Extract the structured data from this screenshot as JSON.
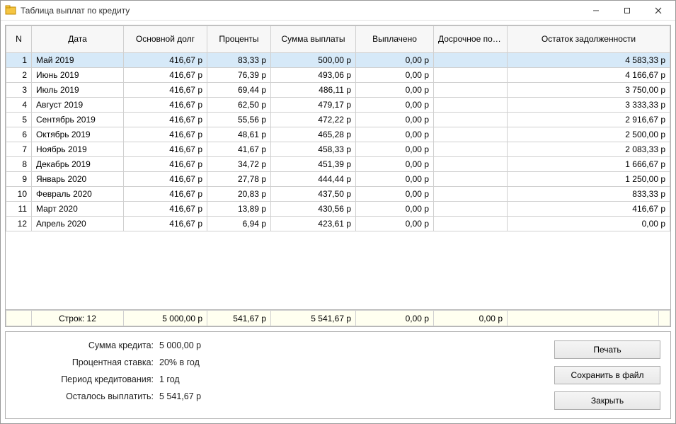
{
  "window": {
    "title": "Таблица выплат по кредиту"
  },
  "columns": {
    "n": "N",
    "date": "Дата",
    "principal": "Основной долг",
    "interest": "Проценты",
    "payment": "Сумма выплаты",
    "paid": "Выплачено",
    "early": "Досрочное погашение",
    "balance": "Остаток задолженности"
  },
  "rows": [
    {
      "n": "1",
      "date": "Май 2019",
      "principal": "416,67 р",
      "interest": "83,33 р",
      "payment": "500,00 р",
      "paid": "0,00 р",
      "early": "",
      "balance": "4 583,33 р"
    },
    {
      "n": "2",
      "date": "Июнь 2019",
      "principal": "416,67 р",
      "interest": "76,39 р",
      "payment": "493,06 р",
      "paid": "0,00 р",
      "early": "",
      "balance": "4 166,67 р"
    },
    {
      "n": "3",
      "date": "Июль 2019",
      "principal": "416,67 р",
      "interest": "69,44 р",
      "payment": "486,11 р",
      "paid": "0,00 р",
      "early": "",
      "balance": "3 750,00 р"
    },
    {
      "n": "4",
      "date": "Август 2019",
      "principal": "416,67 р",
      "interest": "62,50 р",
      "payment": "479,17 р",
      "paid": "0,00 р",
      "early": "",
      "balance": "3 333,33 р"
    },
    {
      "n": "5",
      "date": "Сентябрь 2019",
      "principal": "416,67 р",
      "interest": "55,56 р",
      "payment": "472,22 р",
      "paid": "0,00 р",
      "early": "",
      "balance": "2 916,67 р"
    },
    {
      "n": "6",
      "date": "Октябрь 2019",
      "principal": "416,67 р",
      "interest": "48,61 р",
      "payment": "465,28 р",
      "paid": "0,00 р",
      "early": "",
      "balance": "2 500,00 р"
    },
    {
      "n": "7",
      "date": "Ноябрь 2019",
      "principal": "416,67 р",
      "interest": "41,67 р",
      "payment": "458,33 р",
      "paid": "0,00 р",
      "early": "",
      "balance": "2 083,33 р"
    },
    {
      "n": "8",
      "date": "Декабрь 2019",
      "principal": "416,67 р",
      "interest": "34,72 р",
      "payment": "451,39 р",
      "paid": "0,00 р",
      "early": "",
      "balance": "1 666,67 р"
    },
    {
      "n": "9",
      "date": "Январь 2020",
      "principal": "416,67 р",
      "interest": "27,78 р",
      "payment": "444,44 р",
      "paid": "0,00 р",
      "early": "",
      "balance": "1 250,00 р"
    },
    {
      "n": "10",
      "date": "Февраль 2020",
      "principal": "416,67 р",
      "interest": "20,83 р",
      "payment": "437,50 р",
      "paid": "0,00 р",
      "early": "",
      "balance": "833,33 р"
    },
    {
      "n": "11",
      "date": "Март 2020",
      "principal": "416,67 р",
      "interest": "13,89 р",
      "payment": "430,56 р",
      "paid": "0,00 р",
      "early": "",
      "balance": "416,67 р"
    },
    {
      "n": "12",
      "date": "Апрель 2020",
      "principal": "416,67 р",
      "interest": "6,94 р",
      "payment": "423,61 р",
      "paid": "0,00 р",
      "early": "",
      "balance": "0,00 р"
    }
  ],
  "totals": {
    "rows_label": "Строк: 12",
    "principal": "5 000,00 р",
    "interest": "541,67 р",
    "payment": "5 541,67 р",
    "paid": "0,00 р",
    "early": "0,00 р",
    "balance": ""
  },
  "summary": {
    "amount_label": "Сумма кредита:",
    "amount_value": "5 000,00 р",
    "rate_label": "Процентная ставка:",
    "rate_value": "20% в год",
    "period_label": "Период кредитования:",
    "period_value": "1 год",
    "remaining_label": "Осталось выплатить:",
    "remaining_value": "5 541,67 р"
  },
  "buttons": {
    "print": "Печать",
    "save": "Сохранить в файл",
    "close": "Закрыть"
  }
}
